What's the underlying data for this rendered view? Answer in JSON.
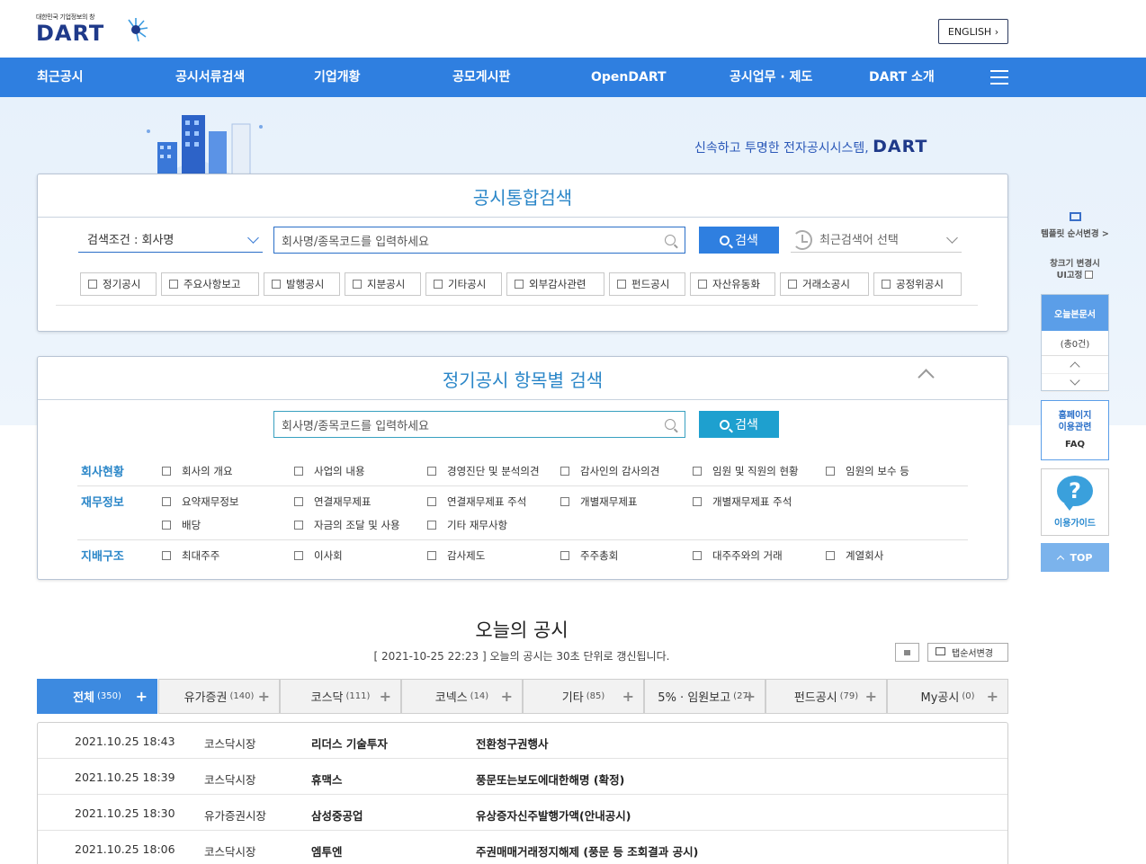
{
  "header": {
    "logo_tagline": "대한민국 기업정보의 창",
    "logo_text": "DART",
    "english_btn": "ENGLISH"
  },
  "nav": {
    "items": [
      "최근공시",
      "공시서류검색",
      "기업개황",
      "공모게시판",
      "OpenDART",
      "공시업무 · 제도",
      "DART 소개"
    ]
  },
  "hero": {
    "tagline": "신속하고 투명한 전자공시시스템,",
    "tagline_brand": "DART"
  },
  "integrated_search": {
    "title": "공시통합검색",
    "condition_select": "검색조건 : 회사명",
    "input_placeholder": "회사명/종목코드를 입력하세요",
    "search_btn": "검색",
    "recent_select": "최근검색어 선택",
    "types": [
      "정기공시",
      "주요사항보고",
      "발행공시",
      "지분공시",
      "기타공시",
      "외부감사관련",
      "펀드공시",
      "자산유동화",
      "거래소공시",
      "공정위공시"
    ]
  },
  "item_search": {
    "title": "정기공시 항목별 검색",
    "input_placeholder": "회사명/종목코드를 입력하세요",
    "search_btn": "검색",
    "categories": [
      {
        "label": "회사현황",
        "rows": [
          [
            "회사의 개요",
            "사업의 내용",
            "경영진단 및 분석의견",
            "감사인의 감사의견",
            "임원 및 직원의 현황",
            "임원의 보수 등"
          ]
        ]
      },
      {
        "label": "재무정보",
        "rows": [
          [
            "요약재무정보",
            "연결재무제표",
            "연결재무제표 주석",
            "개별재무제표",
            "개별재무제표 주석"
          ],
          [
            "배당",
            "자금의 조달 및 사용",
            "기타 재무사항"
          ]
        ]
      },
      {
        "label": "지배구조",
        "rows": [
          [
            "최대주주",
            "이사회",
            "감사제도",
            "주주총회",
            "대주주와의 거래",
            "계열회사"
          ]
        ]
      }
    ]
  },
  "today": {
    "title": "오늘의 공시",
    "subtitle": "[ 2021-10-25 22:23 ] 오늘의 공시는 30초 단위로 갱신됩니다.",
    "tab_order_btn": "탭순서변경",
    "tabs": [
      {
        "label": "전체",
        "count": "(350)"
      },
      {
        "label": "유가증권",
        "count": "(140)"
      },
      {
        "label": "코스닥",
        "count": "(111)"
      },
      {
        "label": "코넥스",
        "count": "(14)"
      },
      {
        "label": "기타",
        "count": "(85)"
      },
      {
        "label": "5% · 임원보고",
        "count": "(27)"
      },
      {
        "label": "펀드공시",
        "count": "(79)"
      },
      {
        "label": "My공시",
        "count": "(0)"
      }
    ],
    "rows": [
      {
        "time": "2021.10.25 18:43",
        "market": "코스닥시장",
        "company": "리더스 기술투자",
        "report": "전환청구권행사"
      },
      {
        "time": "2021.10.25 18:39",
        "market": "코스닥시장",
        "company": "휴맥스",
        "report": "풍문또는보도에대한해명 (확정)"
      },
      {
        "time": "2021.10.25 18:30",
        "market": "유가증권시장",
        "company": "삼성중공업",
        "report": "유상증자신주발행가액(안내공시)"
      },
      {
        "time": "2021.10.25 18:06",
        "market": "코스닥시장",
        "company": "엠투엔",
        "report": "주권매매거래정지해제 (풍문 등 조회결과 공시)"
      }
    ]
  },
  "sidebar": {
    "template_order": "템플릿 순서변경 >",
    "window_fix_line1": "창크기 변경시",
    "window_fix_line2": "UI고정",
    "today_docs": "오늘본문서",
    "today_docs_count": "(총0건)",
    "faq_line1": "홈페이지",
    "faq_line2": "이용관련",
    "faq_line3": "FAQ",
    "guide_icon": "?",
    "guide": "이용가이드",
    "top": "TOP"
  }
}
